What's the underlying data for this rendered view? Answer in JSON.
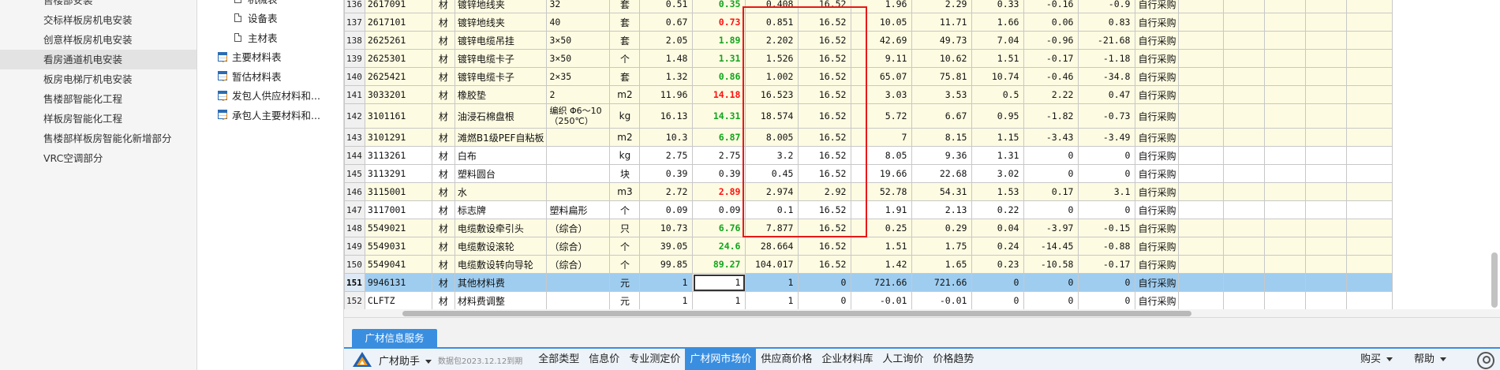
{
  "left_tree": {
    "items": [
      {
        "label": "售楼部安装",
        "partial": true
      },
      {
        "label": "交标样板房机电安装"
      },
      {
        "label": "创意样板房机电安装"
      },
      {
        "label": "看房通道机电安装",
        "selected": true
      },
      {
        "label": "板房电梯厅机电安装"
      },
      {
        "label": "售楼部智能化工程"
      },
      {
        "label": "样板房智能化工程"
      },
      {
        "label": "售楼部样板房智能化新增部分"
      },
      {
        "label": "VRC空调部分"
      }
    ]
  },
  "mid_tree": {
    "items": [
      {
        "label": "机械表",
        "level": 2,
        "icon": "document-icon",
        "partial": true
      },
      {
        "label": "设备表",
        "level": 2,
        "icon": "document-icon"
      },
      {
        "label": "主材表",
        "level": 2,
        "icon": "document-icon"
      },
      {
        "label": "主要材料表",
        "level": 1,
        "icon": "table-icon"
      },
      {
        "label": "暂估材料表",
        "level": 1,
        "icon": "table-icon"
      },
      {
        "label": "发包人供应材料和...",
        "level": 1,
        "icon": "table-icon"
      },
      {
        "label": "承包人主要材料和...",
        "level": 1,
        "icon": "table-icon"
      }
    ]
  },
  "grid": {
    "rows": [
      {
        "no": "136",
        "code": "2617091",
        "type": "材",
        "name": "镀锌地线夹",
        "spec": "32",
        "unit": "套",
        "qty": "0.51",
        "price": "0.35",
        "price_color": "green",
        "total": "0.408",
        "c1": "16.52",
        "c2": "1.96",
        "c3": "2.29",
        "c4": "0.33",
        "c5": "-0.16",
        "c6": "-0.9",
        "src": "自行采购"
      },
      {
        "no": "137",
        "code": "2617101",
        "type": "材",
        "name": "镀锌地线夹",
        "spec": "40",
        "unit": "套",
        "qty": "0.67",
        "price": "0.73",
        "price_color": "red",
        "total": "0.851",
        "c1": "16.52",
        "c2": "10.05",
        "c3": "11.71",
        "c4": "1.66",
        "c5": "0.06",
        "c6": "0.83",
        "src": "自行采购"
      },
      {
        "no": "138",
        "code": "2625261",
        "type": "材",
        "name": "镀锌电缆吊挂",
        "spec": "3×50",
        "unit": "套",
        "qty": "2.05",
        "price": "1.89",
        "price_color": "green",
        "total": "2.202",
        "c1": "16.52",
        "c2": "42.69",
        "c3": "49.73",
        "c4": "7.04",
        "c5": "-0.96",
        "c6": "-21.68",
        "src": "自行采购"
      },
      {
        "no": "139",
        "code": "2625301",
        "type": "材",
        "name": "镀锌电缆卡子",
        "spec": "3×50",
        "unit": "个",
        "qty": "1.48",
        "price": "1.31",
        "price_color": "green",
        "total": "1.526",
        "c1": "16.52",
        "c2": "9.11",
        "c3": "10.62",
        "c4": "1.51",
        "c5": "-0.17",
        "c6": "-1.18",
        "src": "自行采购"
      },
      {
        "no": "140",
        "code": "2625421",
        "type": "材",
        "name": "镀锌电缆卡子",
        "spec": "2×35",
        "unit": "套",
        "qty": "1.32",
        "price": "0.86",
        "price_color": "green",
        "total": "1.002",
        "c1": "16.52",
        "c2": "65.07",
        "c3": "75.81",
        "c4": "10.74",
        "c5": "-0.46",
        "c6": "-34.8",
        "src": "自行采购"
      },
      {
        "no": "141",
        "code": "3033201",
        "type": "材",
        "name": "橡胶垫",
        "spec": "2",
        "unit": "m2",
        "qty": "11.96",
        "price": "14.18",
        "price_color": "red",
        "total": "16.523",
        "c1": "16.52",
        "c2": "3.03",
        "c3": "3.53",
        "c4": "0.5",
        "c5": "2.22",
        "c6": "0.47",
        "src": "自行采购"
      },
      {
        "no": "142",
        "code": "3101161",
        "type": "材",
        "name": "油浸石棉盘根",
        "spec": "编织 Φ6～10（250℃）",
        "unit": "kg",
        "qty": "16.13",
        "price": "14.31",
        "price_color": "green",
        "total": "18.574",
        "c1": "16.52",
        "c2": "5.72",
        "c3": "6.67",
        "c4": "0.95",
        "c5": "-1.82",
        "c6": "-0.73",
        "src": "自行采购",
        "tall": true
      },
      {
        "no": "143",
        "code": "3101291",
        "type": "材",
        "name": "滩燃B1级PEF自粘板",
        "spec": "",
        "unit": "m2",
        "qty": "10.3",
        "price": "6.87",
        "price_color": "green",
        "total": "8.005",
        "c1": "16.52",
        "c2": "7",
        "c3": "8.15",
        "c4": "1.15",
        "c5": "-3.43",
        "c6": "-3.49",
        "src": "自行采购"
      },
      {
        "no": "144",
        "code": "3113261",
        "type": "材",
        "name": "白布",
        "spec": "",
        "unit": "kg",
        "qty": "2.75",
        "price": "2.75",
        "price_color": "black",
        "total": "3.2",
        "c1": "16.52",
        "c2": "8.05",
        "c3": "9.36",
        "c4": "1.31",
        "c5": "0",
        "c6": "0",
        "src": "自行采购",
        "white": true
      },
      {
        "no": "145",
        "code": "3113291",
        "type": "材",
        "name": "塑料圆台",
        "spec": "",
        "unit": "块",
        "qty": "0.39",
        "price": "0.39",
        "price_color": "black",
        "total": "0.45",
        "c1": "16.52",
        "c2": "19.66",
        "c3": "22.68",
        "c4": "3.02",
        "c5": "0",
        "c6": "0",
        "src": "自行采购",
        "white": true
      },
      {
        "no": "146",
        "code": "3115001",
        "type": "材",
        "name": "水",
        "spec": "",
        "unit": "m3",
        "qty": "2.72",
        "price": "2.89",
        "price_color": "red",
        "total": "2.974",
        "c1": "2.92",
        "c2": "52.78",
        "c3": "54.31",
        "c4": "1.53",
        "c5": "0.17",
        "c6": "3.1",
        "src": "自行采购"
      },
      {
        "no": "147",
        "code": "3117001",
        "type": "材",
        "name": "标志牌",
        "spec": "塑料扁形",
        "unit": "个",
        "qty": "0.09",
        "price": "0.09",
        "price_color": "black",
        "total": "0.1",
        "c1": "16.52",
        "c2": "1.91",
        "c3": "2.13",
        "c4": "0.22",
        "c5": "0",
        "c6": "0",
        "src": "自行采购",
        "white": true
      },
      {
        "no": "148",
        "code": "5549021",
        "type": "材",
        "name": "电缆敷设牵引头",
        "spec": "（综合）",
        "unit": "只",
        "qty": "10.73",
        "price": "6.76",
        "price_color": "green",
        "total": "7.877",
        "c1": "16.52",
        "c2": "0.25",
        "c3": "0.29",
        "c4": "0.04",
        "c5": "-3.97",
        "c6": "-0.15",
        "src": "自行采购"
      },
      {
        "no": "149",
        "code": "5549031",
        "type": "材",
        "name": "电缆敷设滚轮",
        "spec": "（综合）",
        "unit": "个",
        "qty": "39.05",
        "price": "24.6",
        "price_color": "green",
        "total": "28.664",
        "c1": "16.52",
        "c2": "1.51",
        "c3": "1.75",
        "c4": "0.24",
        "c5": "-14.45",
        "c6": "-0.88",
        "src": "自行采购"
      },
      {
        "no": "150",
        "code": "5549041",
        "type": "材",
        "name": "电缆敷设转向导轮",
        "spec": "（综合）",
        "unit": "个",
        "qty": "99.85",
        "price": "89.27",
        "price_color": "green",
        "total": "104.017",
        "c1": "16.52",
        "c2": "1.42",
        "c3": "1.65",
        "c4": "0.23",
        "c5": "-10.58",
        "c6": "-0.17",
        "src": "自行采购"
      },
      {
        "no": "151",
        "code": "9946131",
        "type": "材",
        "name": "其他材料费",
        "spec": "",
        "unit": "元",
        "qty": "1",
        "price": "1",
        "price_color": "black",
        "total": "1",
        "c1": "0",
        "c2": "721.66",
        "c3": "721.66",
        "c4": "0",
        "c5": "0",
        "c6": "0",
        "src": "自行采购",
        "selected": true
      },
      {
        "no": "152",
        "code": "CLFTZ",
        "type": "材",
        "name": "材料费调整",
        "spec": "",
        "unit": "元",
        "qty": "1",
        "price": "1",
        "price_color": "black",
        "total": "1",
        "c1": "0",
        "c2": "-0.01",
        "c3": "-0.01",
        "c4": "0",
        "c5": "0",
        "c6": "0",
        "src": "自行采购",
        "white": true
      }
    ]
  },
  "bottom_panel": {
    "service_tab": "广材信息服务",
    "assistant_label": "广材助手",
    "data_package_note": "数据包2023.12.12到期",
    "tabs": [
      "全部类型",
      "信息价",
      "专业测定价",
      "广材网市场价",
      "供应商价格",
      "企业材料库",
      "人工询价",
      "价格趋势"
    ],
    "active_tab": "广材网市场价",
    "buy_label": "购买",
    "help_label": "帮助"
  },
  "colors": {
    "row_highlight": "#fdfbe1",
    "row_selected": "#9fcdf0",
    "price_up": "#ff1010",
    "price_down": "#12a51e",
    "annotation_box": "#e81818",
    "accent_blue": "#3a8ee0"
  },
  "icons": [
    "document-icon",
    "table-icon",
    "guangcai-logo-icon",
    "user-avatar-icon"
  ]
}
